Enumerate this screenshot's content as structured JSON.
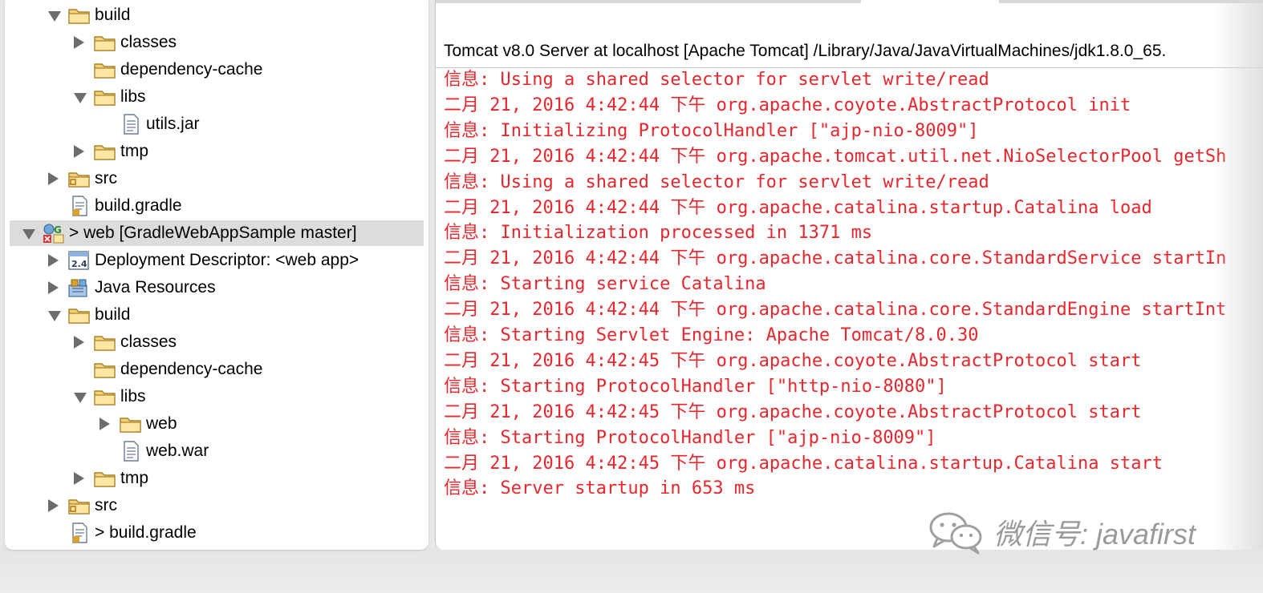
{
  "explorer": {
    "rows": [
      {
        "label": "build",
        "indent": 0,
        "twisty": "open",
        "icon": "folder-icon"
      },
      {
        "label": "classes",
        "indent": 1,
        "twisty": "closed",
        "icon": "folder-icon"
      },
      {
        "label": "dependency-cache",
        "indent": 1,
        "twisty": "none",
        "icon": "folder-icon"
      },
      {
        "label": "libs",
        "indent": 1,
        "twisty": "open",
        "icon": "folder-icon"
      },
      {
        "label": "utils.jar",
        "indent": 2,
        "twisty": "none",
        "icon": "file-icon"
      },
      {
        "label": "tmp",
        "indent": 1,
        "twisty": "closed",
        "icon": "folder-icon"
      },
      {
        "label": "src",
        "indent": 0,
        "twisty": "closed",
        "icon": "source-folder-icon"
      },
      {
        "label": "build.gradle",
        "indent": 0,
        "twisty": "none",
        "icon": "gradle-file-icon"
      },
      {
        "label": "> web  [GradleWebAppSample master]",
        "indent": -1,
        "twisty": "open",
        "icon": "web-project-icon",
        "selected": true
      },
      {
        "label": "Deployment Descriptor: <web app>",
        "indent": 0,
        "twisty": "closed",
        "icon": "deployment-descriptor-icon"
      },
      {
        "label": "Java Resources",
        "indent": 0,
        "twisty": "closed",
        "icon": "java-resources-icon"
      },
      {
        "label": "build",
        "indent": 0,
        "twisty": "open",
        "icon": "folder-icon"
      },
      {
        "label": "classes",
        "indent": 1,
        "twisty": "closed",
        "icon": "folder-icon"
      },
      {
        "label": "dependency-cache",
        "indent": 1,
        "twisty": "none",
        "icon": "folder-icon"
      },
      {
        "label": "libs",
        "indent": 1,
        "twisty": "open",
        "icon": "folder-icon"
      },
      {
        "label": "web",
        "indent": 2,
        "twisty": "closed",
        "icon": "folder-icon"
      },
      {
        "label": "web.war",
        "indent": 2,
        "twisty": "none",
        "icon": "file-icon"
      },
      {
        "label": "tmp",
        "indent": 1,
        "twisty": "closed",
        "icon": "folder-icon"
      },
      {
        "label": "src",
        "indent": 0,
        "twisty": "closed",
        "icon": "source-folder-icon"
      },
      {
        "label": "> build.gradle",
        "indent": 0,
        "twisty": "none",
        "icon": "gradle-file-icon"
      }
    ]
  },
  "console": {
    "header": "Tomcat v8.0 Server at localhost [Apache Tomcat] /Library/Java/JavaVirtualMachines/jdk1.8.0_65.",
    "text_color": "#e8262b",
    "lines": [
      "信息: Using a shared selector for servlet write/read",
      "二月 21, 2016 4:42:44 下午 org.apache.coyote.AbstractProtocol init",
      "信息: Initializing ProtocolHandler [\"ajp-nio-8009\"]",
      "二月 21, 2016 4:42:44 下午 org.apache.tomcat.util.net.NioSelectorPool getSh",
      "信息: Using a shared selector for servlet write/read",
      "二月 21, 2016 4:42:44 下午 org.apache.catalina.startup.Catalina load",
      "信息: Initialization processed in 1371 ms",
      "二月 21, 2016 4:42:44 下午 org.apache.catalina.core.StandardService startIn",
      "信息: Starting service Catalina",
      "二月 21, 2016 4:42:44 下午 org.apache.catalina.core.StandardEngine startInt",
      "信息: Starting Servlet Engine: Apache Tomcat/8.0.30",
      "二月 21, 2016 4:42:45 下午 org.apache.coyote.AbstractProtocol start",
      "信息: Starting ProtocolHandler [\"http-nio-8080\"]",
      "二月 21, 2016 4:42:45 下午 org.apache.coyote.AbstractProtocol start",
      "信息: Starting ProtocolHandler [\"ajp-nio-8009\"]",
      "二月 21, 2016 4:42:45 下午 org.apache.catalina.startup.Catalina start",
      "信息: Server startup in 653 ms"
    ]
  },
  "watermark": {
    "text": "微信号: javafirst",
    "icon": "wechat-logo-icon"
  }
}
